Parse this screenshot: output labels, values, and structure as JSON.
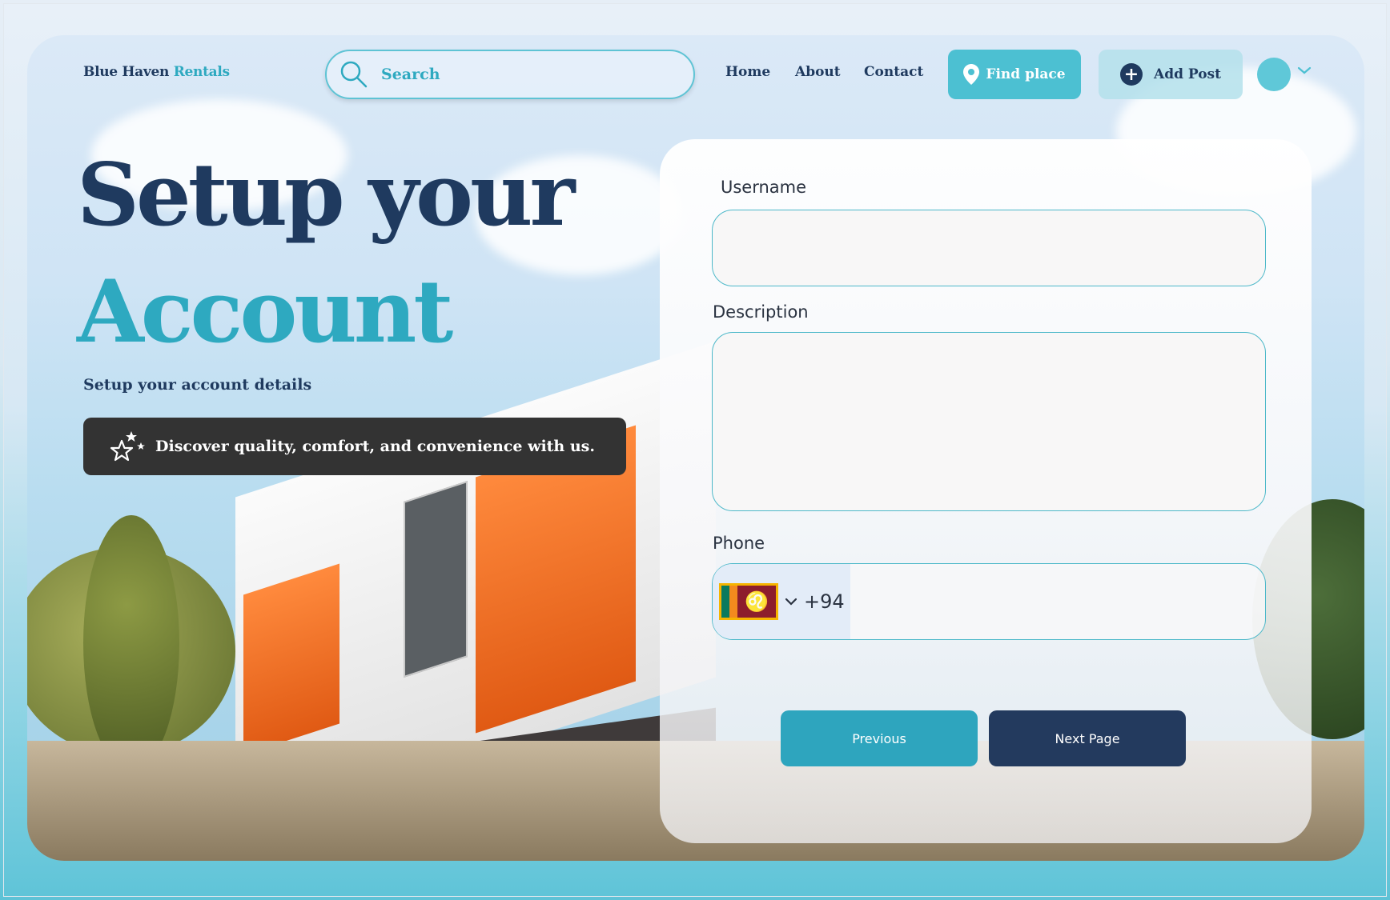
{
  "brand": {
    "name_part1": "Blue Haven",
    "name_part2": "Rentals"
  },
  "search": {
    "placeholder": "Search"
  },
  "nav": {
    "home": "Home",
    "about": "About",
    "contact": "Contact"
  },
  "actions": {
    "find_place": "Find place",
    "add_post": "Add Post"
  },
  "hero": {
    "title_line1": "Setup your",
    "title_line2": "Account",
    "subtitle": "Setup your account details",
    "banner": "Discover quality, comfort, and convenience with us."
  },
  "form": {
    "username_label": "Username",
    "username_value": "",
    "description_label": "Description",
    "description_value": "",
    "phone_label": "Phone",
    "phone_country_code": "+94",
    "phone_value": ""
  },
  "buttons": {
    "previous": "Previous",
    "next": "Next Page"
  },
  "colors": {
    "navy": "#1f3a5f",
    "teal": "#2ea9c0",
    "accent_button": "#4cc0d2",
    "next_button": "#233a5e",
    "banner_bg": "#333333"
  },
  "icons": {
    "search": "search-icon",
    "find_place": "location-pin-icon",
    "add_post": "plus-circle-icon",
    "avatar_dropdown": "chevron-down-icon",
    "banner": "stars-icon",
    "phone_dropdown": "chevron-down-icon",
    "country_flag": "sri-lanka-flag-icon"
  }
}
